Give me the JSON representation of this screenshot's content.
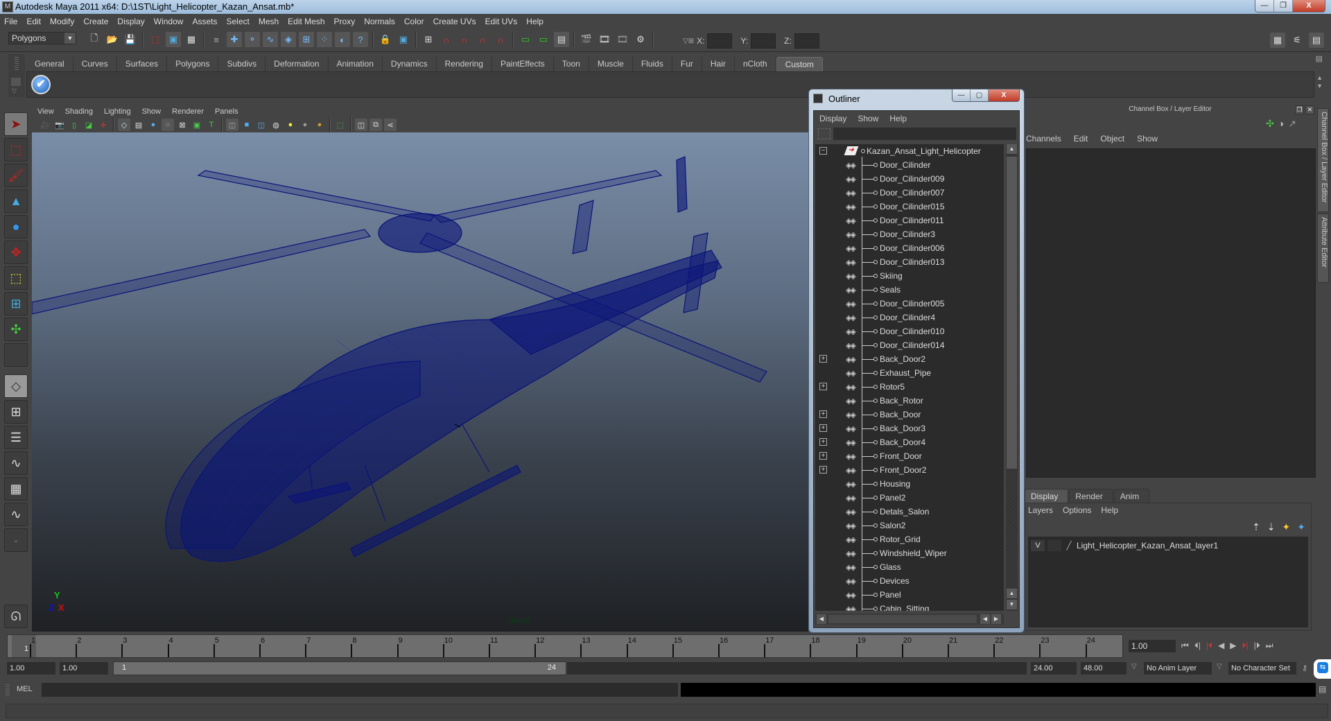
{
  "window": {
    "title": "Autodesk Maya 2011 x64: D:\\1ST\\Light_Helicopter_Kazan_Ansat.mb*",
    "controls": {
      "minimize": "—",
      "maximize": "❐",
      "close": "X"
    }
  },
  "menubar": [
    "File",
    "Edit",
    "Modify",
    "Create",
    "Display",
    "Window",
    "Assets",
    "Select",
    "Mesh",
    "Edit Mesh",
    "Proxy",
    "Normals",
    "Color",
    "Create UVs",
    "Edit UVs",
    "Help"
  ],
  "statusline": {
    "mode": "Polygons",
    "xyz_labels": {
      "x": "X:",
      "y": "Y:",
      "z": "Z:"
    },
    "xyz_values": {
      "x": "",
      "y": "",
      "z": ""
    }
  },
  "shelf": {
    "tabs": [
      "General",
      "Curves",
      "Surfaces",
      "Polygons",
      "Subdivs",
      "Deformation",
      "Animation",
      "Dynamics",
      "Rendering",
      "PaintEffects",
      "Toon",
      "Muscle",
      "Fluids",
      "Fur",
      "Hair",
      "nCloth",
      "Custom"
    ],
    "active_tab": "Custom",
    "items": [
      {
        "icon": "checkmark-icon",
        "glyph": "✔"
      }
    ]
  },
  "viewport": {
    "menu": [
      "View",
      "Shading",
      "Lighting",
      "Show",
      "Renderer",
      "Panels"
    ],
    "camera_label": "persp",
    "axis": {
      "x": "X",
      "y": "Y",
      "z": "Z"
    },
    "wire_color": "#0a1478"
  },
  "outliner": {
    "title": "Outliner",
    "menu": [
      "Display",
      "Show",
      "Help"
    ],
    "filter": "",
    "root": {
      "name": "Kazan_Ansat_Light_Helicopter",
      "expanded": true
    },
    "items": [
      {
        "name": "Door_Cilinder",
        "expandable": false
      },
      {
        "name": "Door_Cilinder009",
        "expandable": false
      },
      {
        "name": "Door_Cilinder007",
        "expandable": false
      },
      {
        "name": "Door_Cilinder015",
        "expandable": false
      },
      {
        "name": "Door_Cilinder011",
        "expandable": false
      },
      {
        "name": "Door_Cilinder3",
        "expandable": false
      },
      {
        "name": "Door_Cilinder006",
        "expandable": false
      },
      {
        "name": "Door_Cilinder013",
        "expandable": false
      },
      {
        "name": "Skiing",
        "expandable": false
      },
      {
        "name": "Seals",
        "expandable": false
      },
      {
        "name": "Door_Cilinder005",
        "expandable": false
      },
      {
        "name": "Door_Cilinder4",
        "expandable": false
      },
      {
        "name": "Door_Cilinder010",
        "expandable": false
      },
      {
        "name": "Door_Cilinder014",
        "expandable": false
      },
      {
        "name": "Back_Door2",
        "expandable": true
      },
      {
        "name": "Exhaust_Pipe",
        "expandable": false
      },
      {
        "name": "Rotor5",
        "expandable": true
      },
      {
        "name": "Back_Rotor",
        "expandable": false
      },
      {
        "name": "Back_Door",
        "expandable": true
      },
      {
        "name": "Back_Door3",
        "expandable": true
      },
      {
        "name": "Back_Door4",
        "expandable": true
      },
      {
        "name": "Front_Door",
        "expandable": true
      },
      {
        "name": "Front_Door2",
        "expandable": true
      },
      {
        "name": "Housing",
        "expandable": false
      },
      {
        "name": "Panel2",
        "expandable": false
      },
      {
        "name": "Detals_Salon",
        "expandable": false
      },
      {
        "name": "Salon2",
        "expandable": false
      },
      {
        "name": "Rotor_Grid",
        "expandable": false
      },
      {
        "name": "Windshield_Wiper",
        "expandable": false
      },
      {
        "name": "Glass",
        "expandable": false
      },
      {
        "name": "Devices",
        "expandable": false
      },
      {
        "name": "Panel",
        "expandable": false
      },
      {
        "name": "Cabin_Sitting",
        "expandable": false
      }
    ]
  },
  "channel_box": {
    "title": "Channel Box / Layer Editor",
    "menu": [
      "Channels",
      "Edit",
      "Object",
      "Show"
    ]
  },
  "side_tabs": [
    "Channel Box / Layer Editor",
    "Attribute Editor"
  ],
  "layer_editor": {
    "tabs": [
      "Display",
      "Render",
      "Anim"
    ],
    "active_tab": "Display",
    "menu": [
      "Layers",
      "Options",
      "Help"
    ],
    "layers": [
      {
        "visible": "V",
        "name": "Light_Helicopter_Kazan_Ansat_layer1"
      }
    ]
  },
  "timeline": {
    "ticks": [
      "1",
      "2",
      "3",
      "4",
      "5",
      "6",
      "7",
      "8",
      "9",
      "10",
      "11",
      "12",
      "13",
      "14",
      "15",
      "16",
      "17",
      "18",
      "19",
      "20",
      "21",
      "22",
      "23",
      "24"
    ],
    "current_frame_marker": "1",
    "current_frame": "1.00"
  },
  "range": {
    "start_time": "1.00",
    "playback_start": "1.00",
    "slider_start": "1",
    "slider_end": "24",
    "playback_end": "24.00",
    "end_time": "48.00",
    "anim_layer": "No Anim Layer",
    "character_set": "No Character Set"
  },
  "mel": {
    "label": "MEL",
    "input": "",
    "output": ""
  },
  "help_line": ""
}
